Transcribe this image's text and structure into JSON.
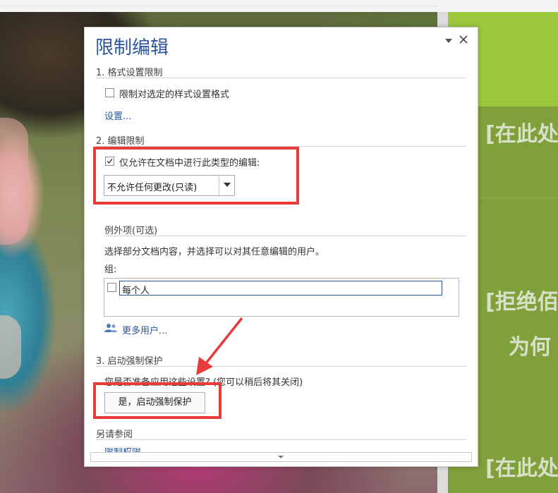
{
  "dialog": {
    "title": "限制编辑",
    "section1": {
      "heading": "1. 格式设置限制",
      "checkbox_label": "限制对选定的样式设置格式",
      "checked": false,
      "settings_link": "设置..."
    },
    "section2": {
      "heading": "2. 编辑限制",
      "checkbox_label": "仅允许在文档中进行此类型的编辑:",
      "checked": true,
      "select_value": "不允许任何更改(只读)"
    },
    "exceptions": {
      "heading": "例外项(可选)",
      "description": "选择部分文档内容，并选择可以对其任意编辑的用户。",
      "group_label": "组:",
      "group_item": "每个人",
      "group_item_checked": false,
      "more_users_link": "更多用户..."
    },
    "section3": {
      "heading": "3. 启动强制保护",
      "question": "您是否准备应用这些设置? (您可以稍后将其关闭)",
      "button_label": "是，启动强制保护"
    },
    "see_also": {
      "heading": "另请参阅",
      "link": "限制权限..."
    }
  },
  "slide": {
    "text1": "[在此处",
    "text2": "[拒绝佰",
    "text3": "为何",
    "text4": "[在此处"
  },
  "colors": {
    "accent": "#2b579a",
    "highlight": "#ea3b3b",
    "slide_green": "#7fa03a",
    "slide_band": "#9cc83c"
  }
}
